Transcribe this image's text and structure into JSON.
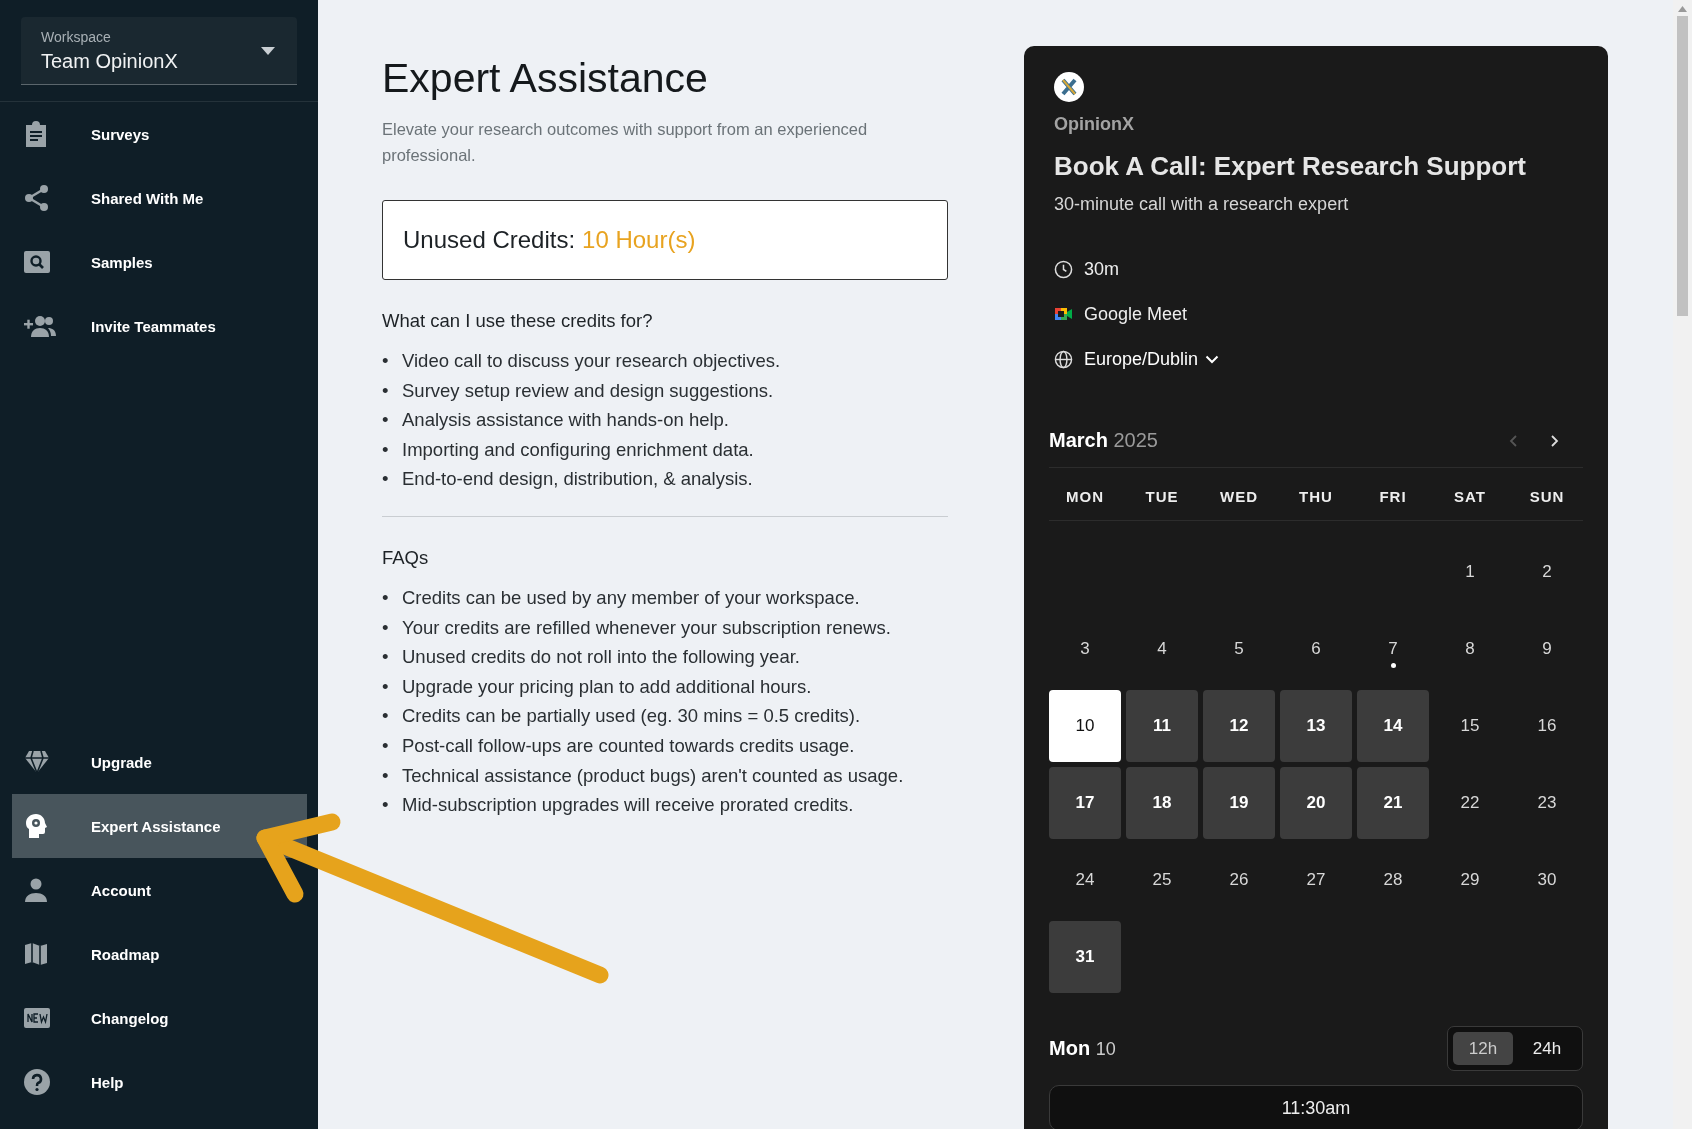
{
  "sidebar": {
    "workspace": {
      "label": "Workspace",
      "value": "Team OpinionX"
    },
    "top_items": [
      {
        "label": "Surveys",
        "selected": false
      },
      {
        "label": "Shared With Me",
        "selected": false
      },
      {
        "label": "Samples",
        "selected": false
      },
      {
        "label": "Invite Teammates",
        "selected": false
      }
    ],
    "bottom_items": [
      {
        "label": "Upgrade",
        "selected": false
      },
      {
        "label": "Expert Assistance",
        "selected": true
      },
      {
        "label": "Account",
        "selected": false
      },
      {
        "label": "Roadmap",
        "selected": false
      },
      {
        "label": "Changelog",
        "selected": false
      },
      {
        "label": "Help",
        "selected": false
      }
    ]
  },
  "main": {
    "title": "Expert Assistance",
    "subtitle": "Elevate your research outcomes with support from an experienced professional.",
    "credits": {
      "label": "Unused Credits:",
      "value": "10 Hour(s)"
    },
    "uses": {
      "heading": "What can I use these credits for?",
      "items": [
        {
          "marker": "•",
          "text": "Video call to discuss your research objectives."
        },
        {
          "marker": "•",
          "text": "Survey setup review and design suggestions."
        },
        {
          "marker": "•",
          "text": "Analysis assistance with hands-on help."
        },
        {
          "marker": "•",
          "text": "Importing and configuring enrichment data."
        },
        {
          "marker": "•",
          "text": "End-to-end design, distribution, & analysis."
        }
      ]
    },
    "faqs": {
      "heading": "FAQs",
      "items": [
        {
          "marker": "•",
          "text": "Credits can be used by any member of your workspace."
        },
        {
          "marker": "•",
          "text": "Your credits are refilled whenever your subscription renews."
        },
        {
          "marker": "•",
          "text": "Unused credits do not roll into the following year."
        },
        {
          "marker": "•",
          "text": "Upgrade your pricing plan to add additional hours."
        },
        {
          "marker": "•",
          "text": "Credits can be partially used (eg. 30 mins = 0.5 credits)."
        },
        {
          "marker": "•",
          "text": "Post-call follow-ups are counted towards credits usage."
        },
        {
          "marker": "•",
          "text": "Technical assistance (product bugs) aren't counted as usage."
        },
        {
          "marker": "•",
          "text": "Mid-subscription upgrades will receive prorated credits."
        }
      ]
    }
  },
  "booking": {
    "org": "OpinionX",
    "title": "Book A Call: Expert Research Support",
    "description": "30-minute call with a research expert",
    "details": [
      {
        "kind": "duration",
        "text": "30m"
      },
      {
        "kind": "location",
        "text": "Google Meet"
      },
      {
        "kind": "timezone",
        "text": "Europe/Dublin"
      }
    ],
    "calendar": {
      "month": "March",
      "year": "2025",
      "prev": {
        "disabled": true
      },
      "next": {
        "disabled": false
      },
      "weekdays": [
        "MON",
        "TUE",
        "WED",
        "THU",
        "FRI",
        "SAT",
        "SUN"
      ],
      "weeks": [
        {
          "fills_from_end": true,
          "days": [
            {
              "label": "1",
              "available": false,
              "selected": false,
              "today": false
            },
            {
              "label": "2",
              "available": false,
              "selected": false,
              "today": false
            }
          ]
        },
        {
          "fills_from_end": false,
          "days": [
            {
              "label": "3",
              "available": false,
              "selected": false,
              "today": false
            },
            {
              "label": "4",
              "available": false,
              "selected": false,
              "today": false
            },
            {
              "label": "5",
              "available": false,
              "selected": false,
              "today": false
            },
            {
              "label": "6",
              "available": false,
              "selected": false,
              "today": false
            },
            {
              "label": "7",
              "available": false,
              "selected": false,
              "today": true
            },
            {
              "label": "8",
              "available": false,
              "selected": false,
              "today": false
            },
            {
              "label": "9",
              "available": false,
              "selected": false,
              "today": false
            }
          ]
        },
        {
          "fills_from_end": false,
          "days": [
            {
              "label": "10",
              "available": true,
              "selected": true,
              "today": false
            },
            {
              "label": "11",
              "available": true,
              "selected": false,
              "today": false
            },
            {
              "label": "12",
              "available": true,
              "selected": false,
              "today": false
            },
            {
              "label": "13",
              "available": true,
              "selected": false,
              "today": false
            },
            {
              "label": "14",
              "available": true,
              "selected": false,
              "today": false
            },
            {
              "label": "15",
              "available": false,
              "selected": false,
              "today": false
            },
            {
              "label": "16",
              "available": false,
              "selected": false,
              "today": false
            }
          ]
        },
        {
          "fills_from_end": false,
          "days": [
            {
              "label": "17",
              "available": true,
              "selected": false,
              "today": false
            },
            {
              "label": "18",
              "available": true,
              "selected": false,
              "today": false
            },
            {
              "label": "19",
              "available": true,
              "selected": false,
              "today": false
            },
            {
              "label": "20",
              "available": true,
              "selected": false,
              "today": false
            },
            {
              "label": "21",
              "available": true,
              "selected": false,
              "today": false
            },
            {
              "label": "22",
              "available": false,
              "selected": false,
              "today": false
            },
            {
              "label": "23",
              "available": false,
              "selected": false,
              "today": false
            }
          ]
        },
        {
          "fills_from_end": false,
          "days": [
            {
              "label": "24",
              "available": false,
              "selected": false,
              "today": false
            },
            {
              "label": "25",
              "available": false,
              "selected": false,
              "today": false
            },
            {
              "label": "26",
              "available": false,
              "selected": false,
              "today": false
            },
            {
              "label": "27",
              "available": false,
              "selected": false,
              "today": false
            },
            {
              "label": "28",
              "available": false,
              "selected": false,
              "today": false
            },
            {
              "label": "29",
              "available": false,
              "selected": false,
              "today": false
            },
            {
              "label": "30",
              "available": false,
              "selected": false,
              "today": false
            }
          ]
        },
        {
          "fills_from_end": false,
          "days": [
            {
              "label": "31",
              "available": true,
              "selected": false,
              "today": false
            }
          ]
        }
      ]
    },
    "slots_header": {
      "weekday": "Mon",
      "day": "10"
    },
    "time_format": [
      {
        "label": "12h",
        "selected": true
      },
      {
        "label": "24h",
        "selected": false
      }
    ],
    "slots": [
      "11:30am"
    ]
  }
}
